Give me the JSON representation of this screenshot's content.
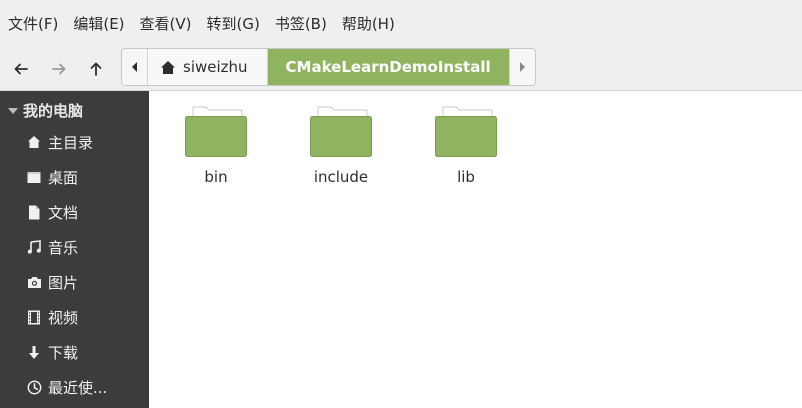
{
  "menu": [
    "文件(F)",
    "编辑(E)",
    "查看(V)",
    "转到(G)",
    "书签(B)",
    "帮助(H)"
  ],
  "path": {
    "home": "siweizhu",
    "current": "CMakeLearnDemoInstall"
  },
  "sidebar": {
    "header": "我的电脑",
    "items": [
      {
        "label": "主目录",
        "icon": "home-icon"
      },
      {
        "label": "桌面",
        "icon": "desktop-icon"
      },
      {
        "label": "文档",
        "icon": "document-icon"
      },
      {
        "label": "音乐",
        "icon": "music-icon"
      },
      {
        "label": "图片",
        "icon": "camera-icon"
      },
      {
        "label": "视频",
        "icon": "film-icon"
      },
      {
        "label": "下载",
        "icon": "download-icon"
      },
      {
        "label": "最近使...",
        "icon": "clock-icon"
      }
    ]
  },
  "files": [
    {
      "name": "bin",
      "icon": "folder-icon"
    },
    {
      "name": "include",
      "icon": "folder-icon"
    },
    {
      "name": "lib",
      "icon": "folder-icon"
    }
  ],
  "colors": {
    "accent": "#8fb35e",
    "folder": "#8fb35e",
    "sidebar": "#3c3c3c"
  }
}
